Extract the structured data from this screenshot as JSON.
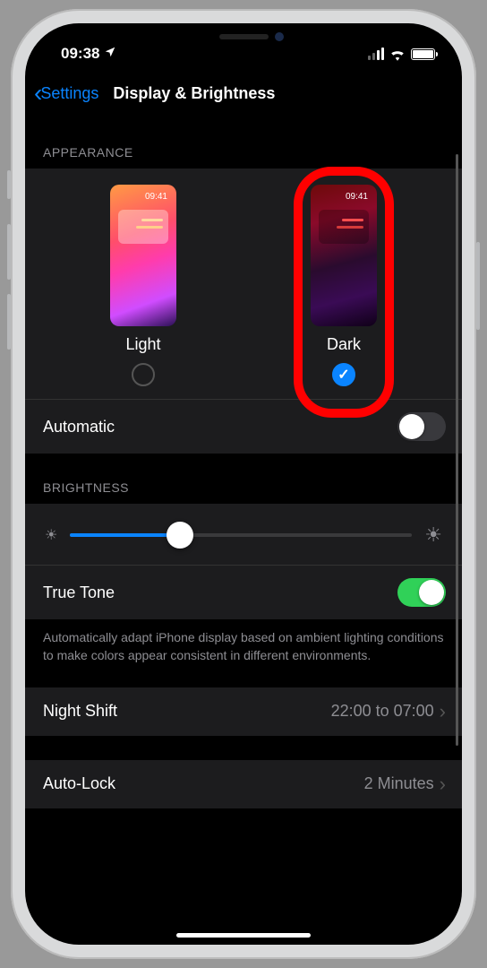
{
  "status": {
    "time": "09:38",
    "location_icon": "location-arrow-icon",
    "battery_pct": 100
  },
  "nav": {
    "back_label": "Settings",
    "title": "Display & Brightness"
  },
  "appearance": {
    "header": "APPEARANCE",
    "light": {
      "label": "Light",
      "thumb_time": "09:41",
      "selected": false
    },
    "dark": {
      "label": "Dark",
      "thumb_time": "09:41",
      "selected": true
    },
    "automatic": {
      "label": "Automatic",
      "on": false
    }
  },
  "brightness": {
    "header": "BRIGHTNESS",
    "value_pct": 32,
    "true_tone": {
      "label": "True Tone",
      "on": true
    },
    "footer": "Automatically adapt iPhone display based on ambient lighting conditions to make colors appear consistent in different environments."
  },
  "night_shift": {
    "label": "Night Shift",
    "value": "22:00 to 07:00"
  },
  "auto_lock": {
    "label": "Auto-Lock",
    "value": "2 Minutes"
  },
  "annotation": {
    "highlight": "dark-option"
  }
}
